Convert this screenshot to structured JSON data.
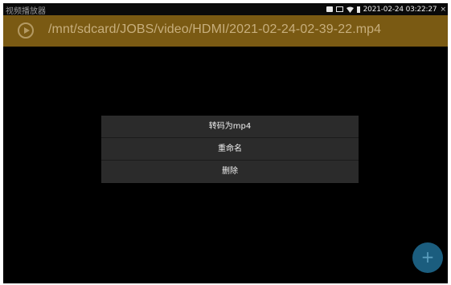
{
  "status_bar": {
    "app_title": "视频播放器",
    "datetime": "2021-02-24 03:22:27",
    "close_glyph": "×"
  },
  "header": {
    "file_path": "/mnt/sdcard/JOBS/video/HDMI/2021-02-24-02-39-22.mp4",
    "background_color": "#7a5a13",
    "icon": "play-icon"
  },
  "context_menu": {
    "items": [
      {
        "label": "转码为mp4"
      },
      {
        "label": "重命名"
      },
      {
        "label": "删除"
      }
    ]
  },
  "fab": {
    "glyph": "+",
    "color": "#1b5d7e",
    "icon": "add-icon"
  }
}
